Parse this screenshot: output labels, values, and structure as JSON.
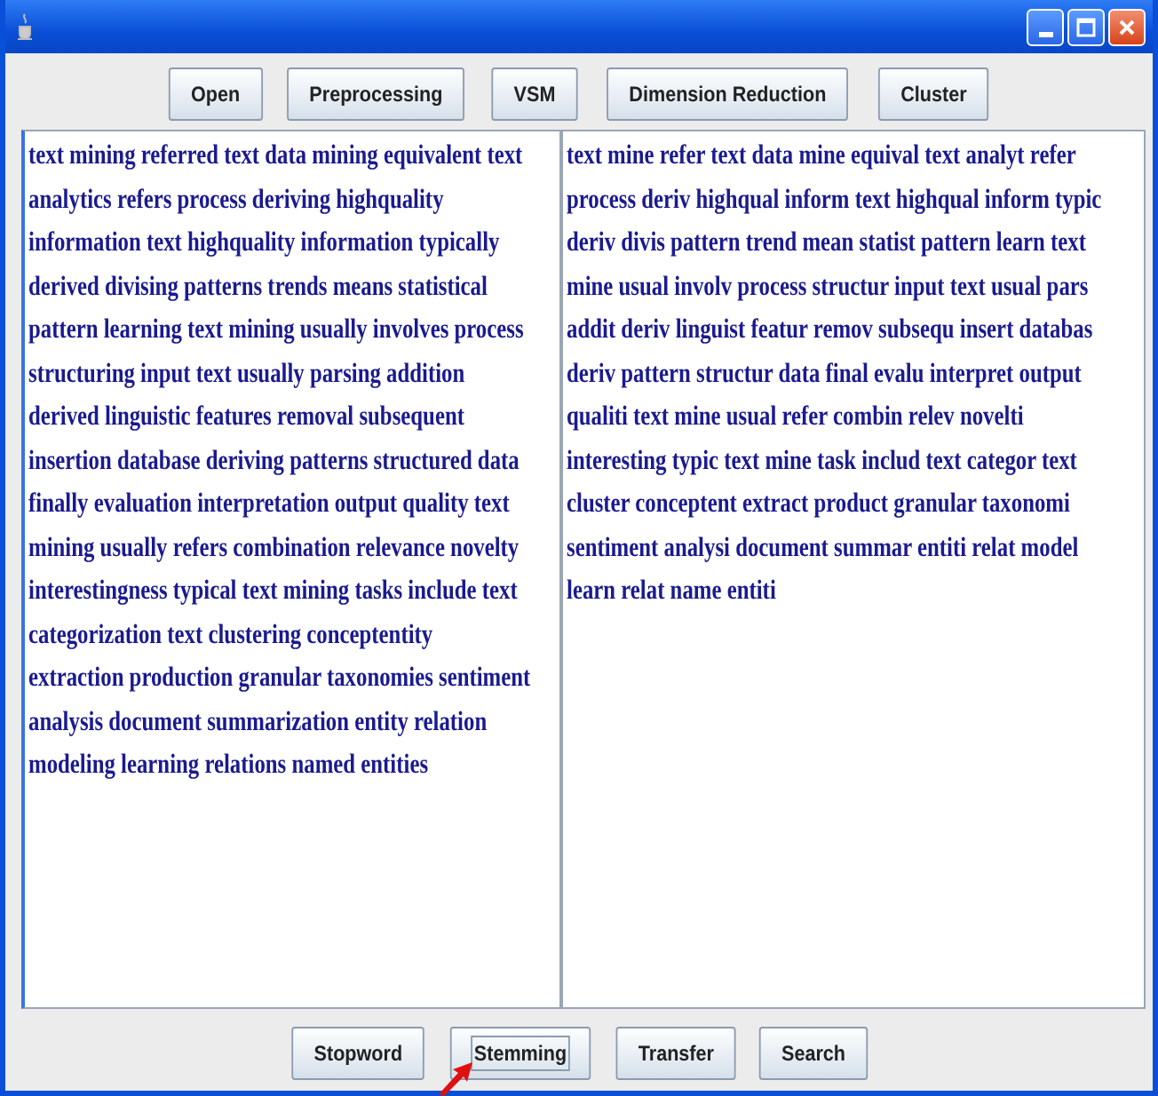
{
  "window": {
    "title_bar": {
      "controls": [
        {
          "kind": "minimize"
        },
        {
          "kind": "maximize"
        },
        {
          "kind": "close"
        }
      ]
    }
  },
  "toolbar": {
    "buttons": [
      {
        "label": "Open"
      },
      {
        "label": "Preprocessing"
      },
      {
        "label": "VSM"
      },
      {
        "label": "Dimension Reduction"
      },
      {
        "label": "Cluster"
      }
    ]
  },
  "panes": [
    {
      "lines": [
        "text mining referred text data mining equivalent text",
        "analytics refers process deriving highquality",
        "information text highquality information typically",
        "derived divising patterns trends means statistical",
        "pattern learning text mining usually involves process",
        "structuring input text usually parsing addition",
        "derived linguistic features removal subsequent",
        "insertion database deriving patterns structured data",
        "finally evaluation interpretation output quality text",
        "mining usually refers combination relevance novelty",
        "interestingness typical text mining tasks include text",
        "categorization text clustering conceptentity",
        "extraction production granular taxonomies sentiment",
        "analysis document summarization entity relation",
        "modeling learning relations named entities"
      ]
    },
    {
      "lines": [
        "text mine refer text data mine equival text analyt refer",
        "process deriv highqual inform text highqual inform typic",
        "deriv divis pattern trend mean statist pattern learn text",
        "mine usual involv process structur input text usual pars",
        "addit deriv linguist featur remov subsequ insert databas",
        "deriv pattern structur data final evalu interpret output",
        "qualiti text mine usual refer combin relev novelti",
        "interesting typic text mine task includ text categor text",
        "cluster conceptent extract product granular taxonomi",
        "sentiment analysi document summar entiti relat model",
        "learn relat name entiti"
      ]
    }
  ],
  "bottom_bar": {
    "buttons": [
      {
        "label": "Stopword",
        "focused": false
      },
      {
        "label": "Stemming",
        "focused": true
      },
      {
        "label": "Transfer",
        "focused": false
      },
      {
        "label": "Search",
        "focused": false
      }
    ]
  }
}
